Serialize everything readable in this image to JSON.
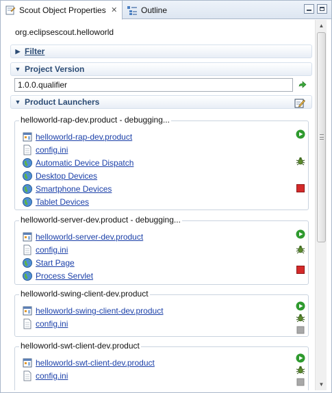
{
  "tabs": [
    {
      "label": "Scout Object Properties",
      "icon": "scout-properties-icon",
      "active": true
    },
    {
      "label": "Outline",
      "icon": "outline-icon",
      "active": false
    }
  ],
  "window_controls": {
    "minimize": "minimize-icon",
    "maximize": "maximize-icon"
  },
  "project_name": "org.eclipsescout.helloworld",
  "sections": {
    "filter": {
      "title": "Filter",
      "expanded": false
    },
    "project_version": {
      "title": "Project Version",
      "expanded": true,
      "value": "1.0.0.qualifier"
    },
    "product_launchers": {
      "title": "Product Launchers",
      "expanded": true
    }
  },
  "launchers": [
    {
      "title": "helloworld-rap-dev.product - debugging...",
      "items": [
        {
          "label": "helloworld-rap-dev.product",
          "icon": "product-icon"
        },
        {
          "label": "config.ini",
          "icon": "file-icon"
        },
        {
          "label": "Automatic Device Dispatch",
          "icon": "globe-icon"
        },
        {
          "label": "Desktop Devices",
          "icon": "globe-icon"
        },
        {
          "label": "Smartphone Devices",
          "icon": "globe-icon"
        },
        {
          "label": "Tablet Devices",
          "icon": "globe-icon"
        }
      ],
      "actions": {
        "run": "enabled",
        "debug": "enabled",
        "stop": "enabled"
      }
    },
    {
      "title": "helloworld-server-dev.product - debugging...",
      "items": [
        {
          "label": "helloworld-server-dev.product",
          "icon": "product-icon"
        },
        {
          "label": "config.ini",
          "icon": "file-icon"
        },
        {
          "label": "Start Page",
          "icon": "globe-icon"
        },
        {
          "label": "Process Servlet",
          "icon": "globe-icon"
        }
      ],
      "actions": {
        "run": "enabled",
        "debug": "enabled",
        "stop": "enabled"
      }
    },
    {
      "title": "helloworld-swing-client-dev.product",
      "items": [
        {
          "label": "helloworld-swing-client-dev.product",
          "icon": "product-icon"
        },
        {
          "label": "config.ini",
          "icon": "file-icon"
        }
      ],
      "actions": {
        "run": "enabled",
        "debug": "enabled",
        "stop": "disabled"
      }
    },
    {
      "title": "helloworld-swt-client-dev.product",
      "items": [
        {
          "label": "helloworld-swt-client-dev.product",
          "icon": "product-icon"
        },
        {
          "label": "config.ini",
          "icon": "file-icon"
        }
      ],
      "actions": {
        "run": "enabled",
        "debug": "enabled",
        "stop": "disabled"
      }
    }
  ],
  "colors": {
    "link": "#1a3fa8",
    "section_title": "#2b4b74",
    "run": "#2e9a2e",
    "stop": "#d42a2a",
    "stop_disabled": "#a8a8a8"
  }
}
